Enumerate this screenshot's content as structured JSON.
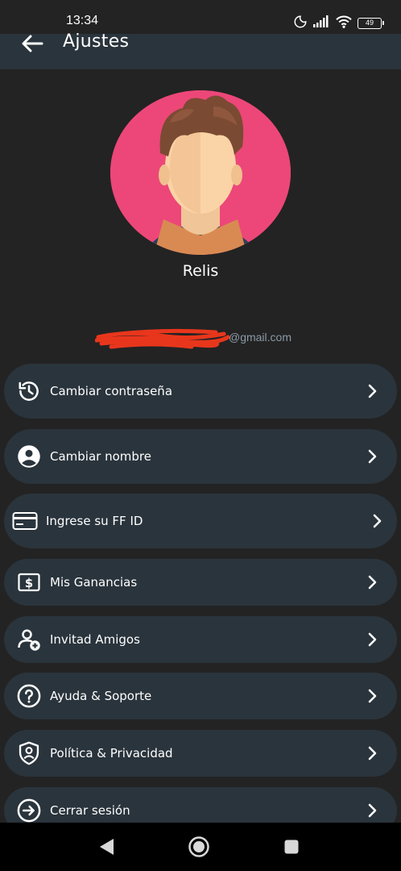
{
  "status_bar": {
    "time": "13:34",
    "battery": "49",
    "icons": [
      "moon-icon",
      "signal-icon",
      "wifi-icon",
      "battery-icon"
    ]
  },
  "app_bar": {
    "title": "Ajustes",
    "back_icon": "arrow-left-icon"
  },
  "profile": {
    "name": "Relis",
    "email_visible": "@gmail.com",
    "email_redacted": true,
    "avatar_bg": "#ec4778"
  },
  "menu": [
    {
      "label": "Cambiar contraseña",
      "icon": "history-icon"
    },
    {
      "label": "Cambiar nombre",
      "icon": "account-circle-icon"
    },
    {
      "label": "Ingrese su FF ID",
      "icon": "credit-card-icon"
    },
    {
      "label": "Mis Ganancias",
      "icon": "dollar-box-icon"
    },
    {
      "label": "Invitad Amigos",
      "icon": "add-user-icon"
    },
    {
      "label": "Ayuda & Soporte",
      "icon": "help-circle-icon"
    },
    {
      "label": "Política & Privacidad",
      "icon": "shield-user-icon"
    },
    {
      "label": "Cerrar sesión",
      "icon": "logout-circle-icon"
    }
  ],
  "nav_bar": {
    "buttons": [
      "back-triangle-icon",
      "home-circle-icon",
      "recents-square-icon"
    ]
  },
  "colors": {
    "background": "#232323",
    "surface": "#2a343c",
    "text": "#ffffff",
    "muted_text": "#8b9aa6",
    "redaction": "#e8361c"
  }
}
